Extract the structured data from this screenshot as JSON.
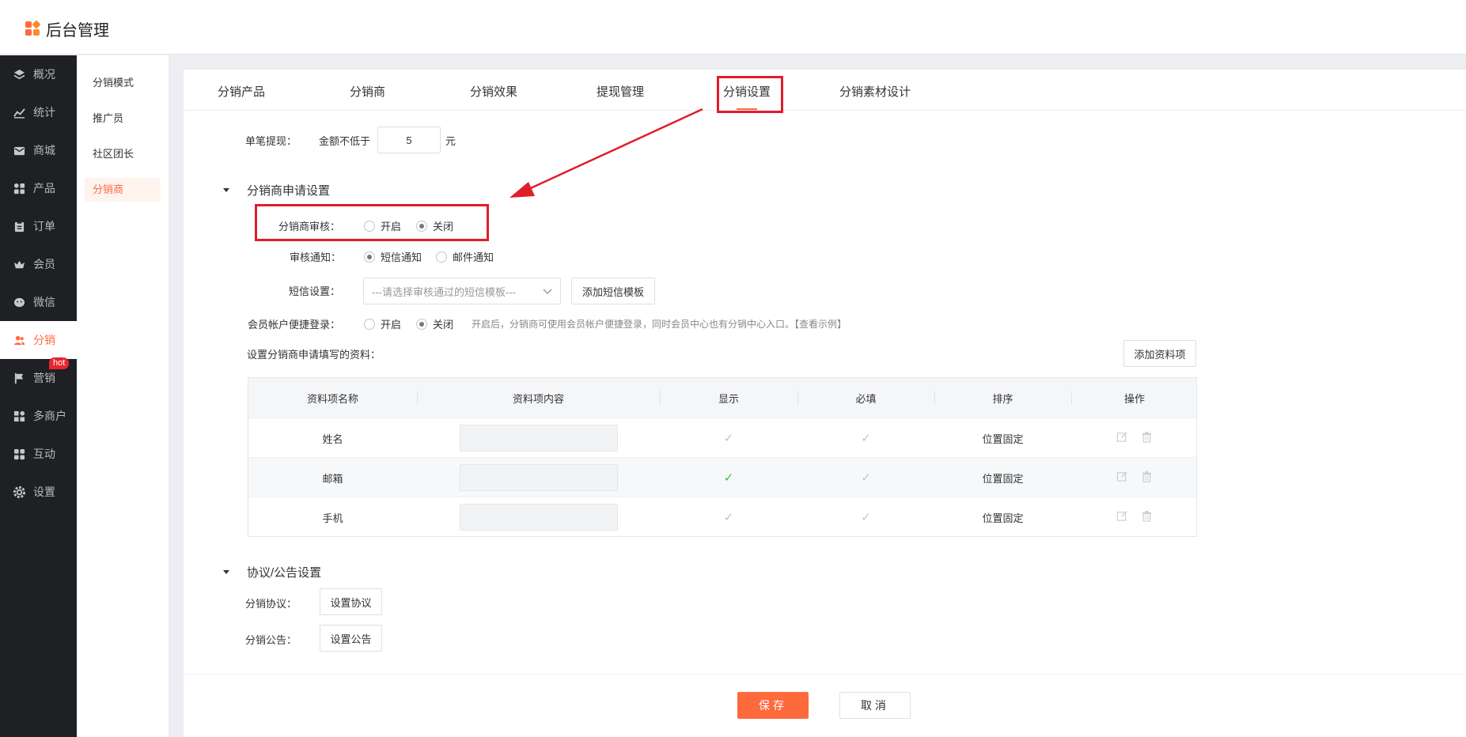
{
  "app": {
    "title": "后台管理"
  },
  "nav": {
    "items": [
      {
        "label": "概况",
        "icon": "layers-icon"
      },
      {
        "label": "统计",
        "icon": "chart-icon"
      },
      {
        "label": "商城",
        "icon": "mail-icon"
      },
      {
        "label": "产品",
        "icon": "grid-icon"
      },
      {
        "label": "订单",
        "icon": "clipboard-icon"
      },
      {
        "label": "会员",
        "icon": "crown-icon"
      },
      {
        "label": "微信",
        "icon": "wechat-icon"
      },
      {
        "label": "分销",
        "icon": "users-icon"
      },
      {
        "label": "营销",
        "icon": "flag-icon",
        "badge": "hot"
      },
      {
        "label": "多商户",
        "icon": "shop-icon"
      },
      {
        "label": "互动",
        "icon": "apps-icon"
      },
      {
        "label": "设置",
        "icon": "gear-icon"
      }
    ],
    "active": "分销"
  },
  "subnav": {
    "items": [
      "分销模式",
      "推广员",
      "社区团长",
      "分销商"
    ],
    "active": "分销商"
  },
  "tabs": {
    "items": [
      "分销产品",
      "分销商",
      "分销效果",
      "提现管理",
      "分销设置",
      "分销素材设计"
    ],
    "active": "分销设置"
  },
  "withdraw": {
    "label": "单笔提现：",
    "prefix": "金额不低于",
    "value": "5",
    "unit": "元"
  },
  "apply_section": {
    "title": "分销商申请设置",
    "review": {
      "label": "分销商审核：",
      "options": [
        "开启",
        "关闭"
      ],
      "selected": "关闭"
    },
    "notify": {
      "label": "审核通知：",
      "options": [
        "短信通知",
        "邮件通知"
      ],
      "selected": "短信通知"
    },
    "sms": {
      "label": "短信设置：",
      "placeholder": "---请选择审核通过的短信模板---",
      "add_button": "添加短信模板"
    },
    "quick_login": {
      "label": "会员帐户便捷登录：",
      "options": [
        "开启",
        "关闭"
      ],
      "selected": "关闭",
      "hint": "开启后，分销商可使用会员帐户便捷登录，同时会员中心也有分销中心入口。【查看示例】"
    },
    "fields": {
      "label": "设置分销商申请填写的资料：",
      "add_button": "添加资料项",
      "columns": [
        "资料项名称",
        "资料项内容",
        "显示",
        "必填",
        "排序",
        "操作"
      ],
      "rows": [
        {
          "name": "姓名",
          "show": "checked-grey",
          "required": "checked-grey",
          "order": "位置固定"
        },
        {
          "name": "邮箱",
          "show": "checked-green",
          "required": "checked-grey",
          "order": "位置固定"
        },
        {
          "name": "手机",
          "show": "checked-grey",
          "required": "checked-grey",
          "order": "位置固定"
        }
      ]
    }
  },
  "agreement_section": {
    "title": "协议/公告设置",
    "agreement": {
      "label": "分销协议：",
      "button": "设置协议"
    },
    "notice": {
      "label": "分销公告：",
      "button": "设置公告"
    }
  },
  "footer": {
    "save": "保存",
    "cancel": "取消"
  },
  "colors": {
    "accent": "#ff6a3d",
    "highlight_box": "#e11d2a",
    "nav_bg": "#1f2024"
  }
}
